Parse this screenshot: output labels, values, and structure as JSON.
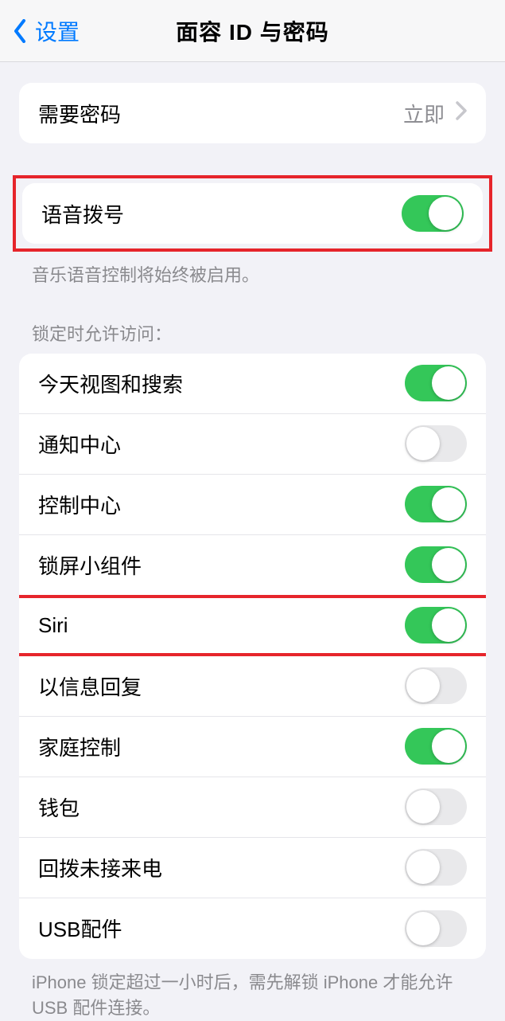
{
  "nav": {
    "back_label": "设置",
    "title": "面容 ID 与密码"
  },
  "passcode": {
    "label": "需要密码",
    "value": "立即"
  },
  "voice_dial": {
    "label": "语音拨号",
    "on": true,
    "footer": "音乐语音控制将始终被启用。"
  },
  "lock_access": {
    "header": "锁定时允许访问：",
    "items": [
      {
        "label": "今天视图和搜索",
        "on": true,
        "name": "today-view-toggle"
      },
      {
        "label": "通知中心",
        "on": false,
        "name": "notification-center-toggle"
      },
      {
        "label": "控制中心",
        "on": true,
        "name": "control-center-toggle"
      },
      {
        "label": "锁屏小组件",
        "on": true,
        "name": "lock-widgets-toggle"
      },
      {
        "label": "Siri",
        "on": true,
        "name": "siri-toggle",
        "highlight": true
      },
      {
        "label": "以信息回复",
        "on": false,
        "name": "reply-with-message-toggle"
      },
      {
        "label": "家庭控制",
        "on": true,
        "name": "home-control-toggle"
      },
      {
        "label": "钱包",
        "on": false,
        "name": "wallet-toggle"
      },
      {
        "label": "回拨未接来电",
        "on": false,
        "name": "return-missed-calls-toggle"
      },
      {
        "label": "USB配件",
        "on": false,
        "name": "usb-accessories-toggle"
      }
    ],
    "footer": "iPhone 锁定超过一小时后，需先解锁 iPhone 才能允许USB 配件连接。"
  }
}
